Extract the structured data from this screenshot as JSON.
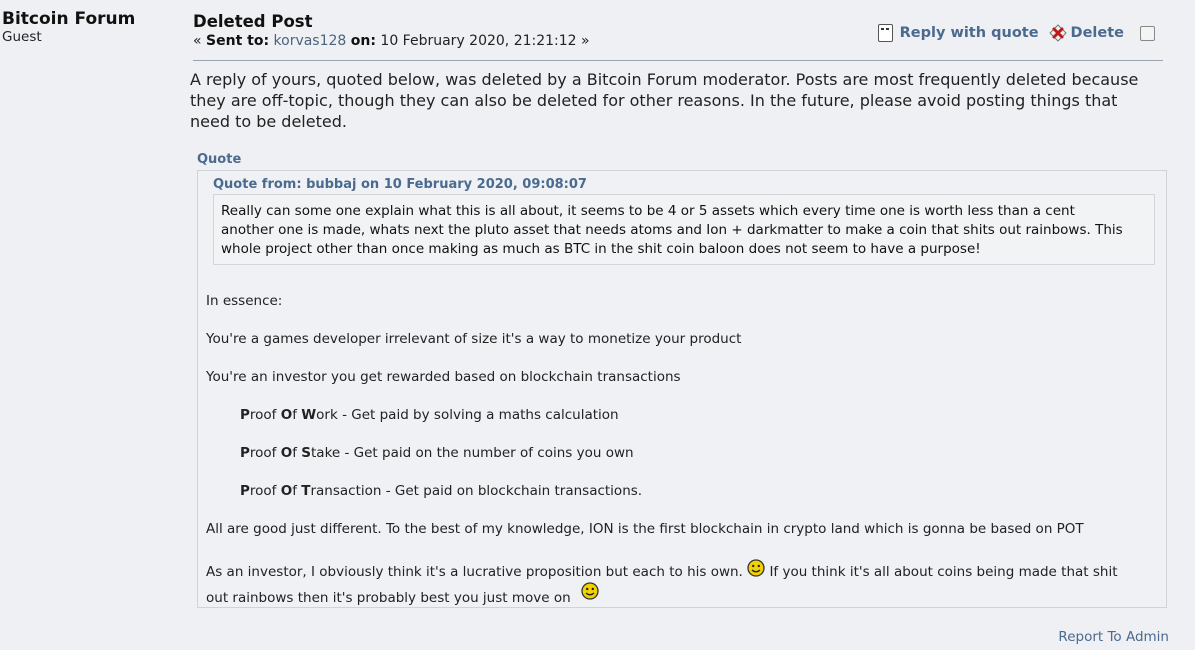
{
  "sender": {
    "name": "Bitcoin Forum",
    "role": "Guest"
  },
  "message": {
    "subject": "Deleted Post",
    "open_guillemet": "«",
    "sent_to_label": "Sent to:",
    "recipient": "korvas128",
    "on_label": "on:",
    "date": "10 February 2020, 21:21:12",
    "close_guillemet": "»"
  },
  "actions": {
    "reply_with_quote": "Reply with quote",
    "delete": "Delete"
  },
  "notice": {
    "line1": "A reply of yours, quoted below, was deleted by a Bitcoin Forum moderator. Posts are most frequently deleted because",
    "line2": "they are off-topic, though they can also be deleted for other reasons. In the future, please avoid posting things that",
    "line3": "need to be deleted."
  },
  "quote": {
    "header": "Quote",
    "inner_header": "Quote from: bubbaj on 10 February 2020, 09:08:07",
    "inner_line1": "Really can some one explain what this is all about, it seems to be 4 or 5 assets which every time one is worth less than a cent",
    "inner_line2": "another one is made, whats next the pluto asset that needs atoms and Ion + darkmatter to make a coin that shits out rainbows. This",
    "inner_line3": "whole project other than once making as much as BTC in the shit coin baloon does not seem to have a purpose!",
    "in_essence": "In essence:",
    "games_dev": "You're a games developer irrelevant of size it's a way to monetize your product",
    "investor": "You're an investor you get rewarded based on blockchain transactions",
    "pow": {
      "p": "P",
      "roof": "roof ",
      "o": "O",
      "f": "f ",
      "w": "W",
      "rest": "ork - Get paid by solving a maths calculation"
    },
    "pos": {
      "p": "P",
      "roof": "roof ",
      "o": "O",
      "f": "f ",
      "s": "S",
      "rest": "take - Get paid on the number of coins you own"
    },
    "pot": {
      "p": "P",
      "roof": "roof ",
      "o": "O",
      "f": "f ",
      "t": "T",
      "rest": "ransaction - Get paid on blockchain transactions."
    },
    "all_good": "All are good just different. To the best of my knowledge, ION is the first blockchain in crypto land which is gonna be based on POT",
    "as_investor_a": "As an investor, I obviously think it's a lucrative proposition but each to his own.",
    "as_investor_b": "If you think it's all about coins being made that shit",
    "as_investor_c": "out rainbows then it's probably best you just move on"
  },
  "footer": {
    "report": "Report To Admin"
  },
  "colors": {
    "link": "#4a6a8f",
    "background": "#eef0f3",
    "quote_bg": "#eff1f4"
  },
  "icons": [
    "reply-quote-icon",
    "delete-icon",
    "smiley-icon"
  ]
}
